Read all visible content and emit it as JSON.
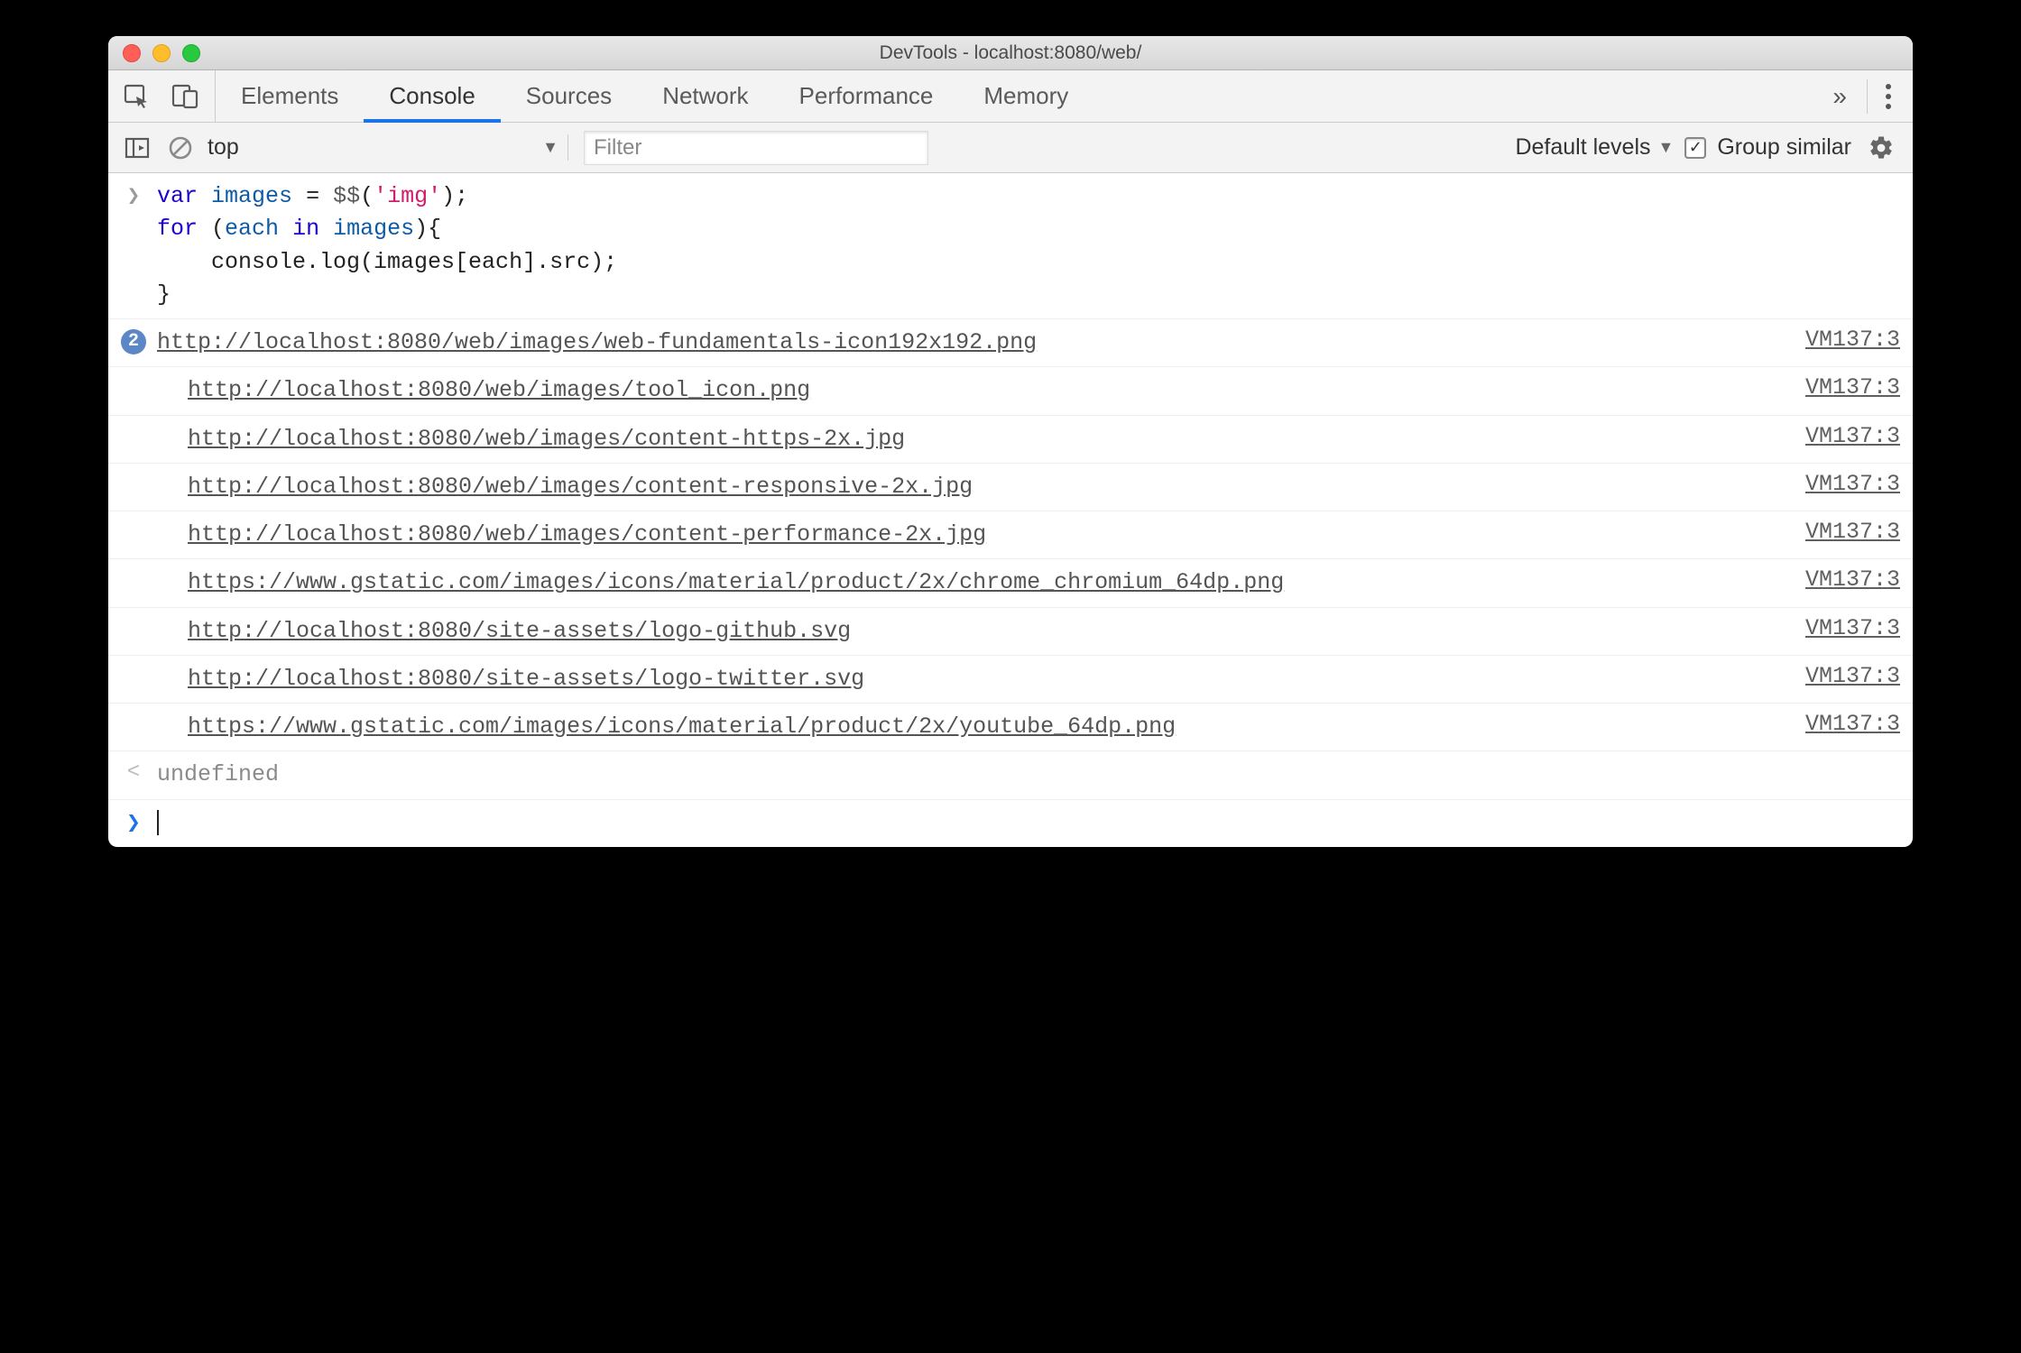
{
  "window": {
    "title": "DevTools - localhost:8080/web/"
  },
  "tabs": {
    "items": [
      "Elements",
      "Console",
      "Sources",
      "Network",
      "Performance",
      "Memory"
    ],
    "active_index": 1,
    "overflow_glyph": "»"
  },
  "filterbar": {
    "context": "top",
    "filter_placeholder": "Filter",
    "levels_label": "Default levels",
    "group_similar_label": "Group similar",
    "group_similar_checked": true
  },
  "input_code": {
    "lines": [
      [
        {
          "cls": "tk-kw",
          "t": "var"
        },
        {
          "cls": "tk-punc",
          "t": " "
        },
        {
          "cls": "tk-var",
          "t": "images"
        },
        {
          "cls": "tk-punc",
          "t": " "
        },
        {
          "cls": "tk-assign",
          "t": "="
        },
        {
          "cls": "tk-punc",
          "t": " "
        },
        {
          "cls": "tk-func",
          "t": "$$"
        },
        {
          "cls": "tk-punc",
          "t": "("
        },
        {
          "cls": "tk-str",
          "t": "'img'"
        },
        {
          "cls": "tk-punc",
          "t": ");"
        }
      ],
      [
        {
          "cls": "tk-kw",
          "t": "for"
        },
        {
          "cls": "tk-punc",
          "t": " ("
        },
        {
          "cls": "tk-var",
          "t": "each"
        },
        {
          "cls": "tk-punc",
          "t": " "
        },
        {
          "cls": "tk-kw",
          "t": "in"
        },
        {
          "cls": "tk-punc",
          "t": " "
        },
        {
          "cls": "tk-var",
          "t": "images"
        },
        {
          "cls": "tk-punc",
          "t": "){"
        }
      ],
      [
        {
          "cls": "tk-punc",
          "t": "    console.log(images[each].src);"
        }
      ],
      [
        {
          "cls": "tk-punc",
          "t": "}"
        }
      ]
    ]
  },
  "logs": [
    {
      "badge": "2",
      "url": "http://localhost:8080/web/images/web-fundamentals-icon192x192.png",
      "source": "VM137:3"
    },
    {
      "url": "http://localhost:8080/web/images/tool_icon.png",
      "source": "VM137:3"
    },
    {
      "url": "http://localhost:8080/web/images/content-https-2x.jpg",
      "source": "VM137:3"
    },
    {
      "url": "http://localhost:8080/web/images/content-responsive-2x.jpg",
      "source": "VM137:3"
    },
    {
      "url": "http://localhost:8080/web/images/content-performance-2x.jpg",
      "source": "VM137:3"
    },
    {
      "url": "https://www.gstatic.com/images/icons/material/product/2x/chrome_chromium_64dp.png",
      "source": "VM137:3"
    },
    {
      "url": "http://localhost:8080/site-assets/logo-github.svg",
      "source": "VM137:3"
    },
    {
      "url": "http://localhost:8080/site-assets/logo-twitter.svg",
      "source": "VM137:3"
    },
    {
      "url": "https://www.gstatic.com/images/icons/material/product/2x/youtube_64dp.png",
      "source": "VM137:3"
    }
  ],
  "result": {
    "value": "undefined"
  }
}
